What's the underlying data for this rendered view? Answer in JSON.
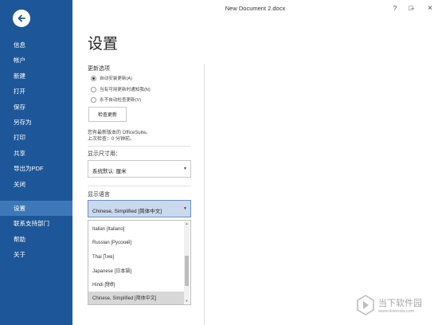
{
  "window": {
    "title": "New Document 2.docx",
    "controls": [
      "?",
      "–",
      "□",
      "×"
    ]
  },
  "sidebar": {
    "back_icon": "back-arrow-icon",
    "items": [
      {
        "label": "信息"
      },
      {
        "label": "帐户"
      },
      {
        "label": "新建"
      },
      {
        "label": "打开"
      },
      {
        "label": "保存"
      },
      {
        "label": "另存为"
      },
      {
        "label": "打印"
      },
      {
        "label": "共享"
      },
      {
        "label": "导出为PDF"
      },
      {
        "label": "关闭"
      },
      {
        "label": "设置",
        "active": true
      },
      {
        "label": "联系支持部门"
      },
      {
        "label": "帮助"
      },
      {
        "label": "关于"
      }
    ],
    "colors": {
      "background": "#1e5799",
      "active": "#3f78b8"
    }
  },
  "main": {
    "title": "设置",
    "update": {
      "label": "更新选项",
      "options": [
        {
          "label": "自动安装更新(A)",
          "checked": true
        },
        {
          "label": "当有可用更新时通知我(N)",
          "checked": false
        },
        {
          "label": "永不自动检查更新(V)",
          "checked": false
        }
      ],
      "check_button": "检查更新",
      "status_line1": "您有最新版本的 OfficeSuite。",
      "status_line2": "上次检查：0 分钟前。"
    },
    "units": {
      "label": "显示尺寸用：",
      "selected": "系统默认: 厘米"
    },
    "language": {
      "label": "显示语言",
      "selected": "Chinese, Simplified [简体中文]",
      "options": [
        "Italian [Italiano]",
        "Russian [Русский]",
        "Thai [ไทย]",
        "Japanese [日本語]",
        "Hindi [हिंदी]",
        "Chinese, Simplified [简体中文]"
      ]
    }
  },
  "watermark": {
    "name": "当下软件园",
    "url": "www.downxia.com"
  }
}
